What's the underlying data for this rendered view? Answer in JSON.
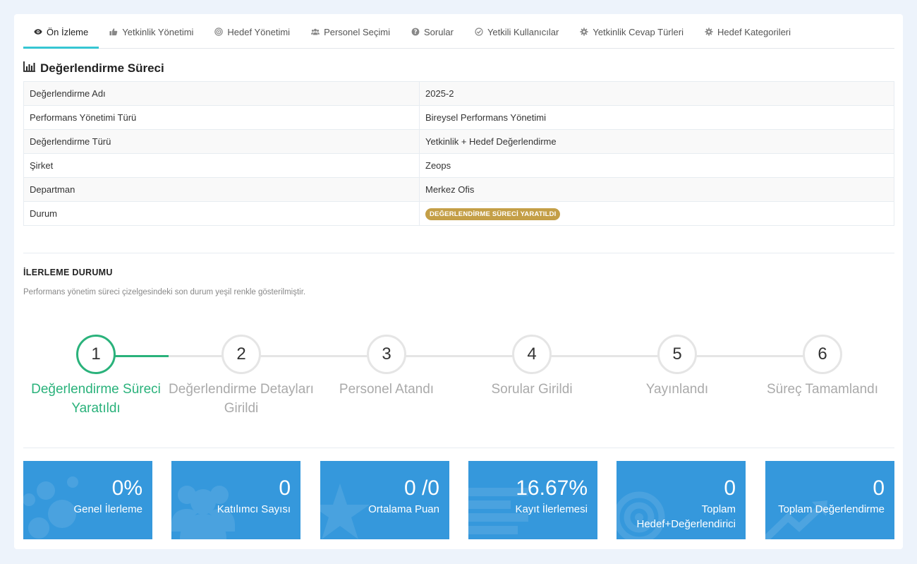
{
  "tabs": [
    {
      "label": "Ön İzleme",
      "icon": "eye-icon",
      "active": true
    },
    {
      "label": "Yetkinlik Yönetimi",
      "icon": "thumbs-up-icon"
    },
    {
      "label": "Hedef Yönetimi",
      "icon": "target-icon"
    },
    {
      "label": "Personel Seçimi",
      "icon": "users-icon"
    },
    {
      "label": "Sorular",
      "icon": "question-icon"
    },
    {
      "label": "Yetkili Kullanıcılar",
      "icon": "check-circle-icon"
    },
    {
      "label": "Yetkinlik Cevap Türleri",
      "icon": "gear-icon"
    },
    {
      "label": "Hedef Kategorileri",
      "icon": "gear-icon"
    }
  ],
  "section": {
    "title": "Değerlendirme Süreci",
    "icon": "bar-chart-icon"
  },
  "info": [
    {
      "key": "Değerlendirme Adı",
      "value": "2025-2"
    },
    {
      "key": "Performans Yönetimi Türü",
      "value": "Bireysel Performans Yönetimi"
    },
    {
      "key": "Değerlendirme Türü",
      "value": "Yetkinlik + Hedef Değerlendirme"
    },
    {
      "key": "Şirket",
      "value": "Zeops"
    },
    {
      "key": "Departman",
      "value": "Merkez Ofis"
    },
    {
      "key": "Durum",
      "value": "DEĞERLENDİRME SÜRECİ YARATILDI",
      "badge_color": "#c49f47"
    }
  ],
  "progress": {
    "heading": "İLERLEME DURUMU",
    "description": "Performans yönetim süreci çizelgesindeki son durum yeşil renkle gösterilmiştir.",
    "done_color": "#2ab27b",
    "steps": [
      {
        "number": "1",
        "label": "Değerlendirme Süreci Yaratıldı",
        "done": true
      },
      {
        "number": "2",
        "label": "Değerlendirme Detayları Girildi",
        "done": false
      },
      {
        "number": "3",
        "label": "Personel Atandı",
        "done": false
      },
      {
        "number": "4",
        "label": "Sorular Girildi",
        "done": false
      },
      {
        "number": "5",
        "label": "Yayınlandı",
        "done": false
      },
      {
        "number": "6",
        "label": "Süreç Tamamlandı",
        "done": false
      }
    ]
  },
  "stats": [
    {
      "value": "0%",
      "label": "Genel İlerleme",
      "icon": "bubbles-icon"
    },
    {
      "value": "0",
      "label": "Katılımcı Sayısı",
      "icon": "users-icon"
    },
    {
      "value": "0 /0",
      "label": "Ortalama Puan",
      "icon": "star-icon"
    },
    {
      "value": "16.67%",
      "label": "Kayıt İlerlemesi",
      "icon": "list-icon"
    },
    {
      "value": "0",
      "label": "Toplam Hedef+Değerlendirici",
      "icon": "target-icon"
    },
    {
      "value": "0",
      "label": "Toplam Değerlendirme",
      "icon": "trend-arrow-icon"
    }
  ],
  "stat_color": "#3598dc"
}
